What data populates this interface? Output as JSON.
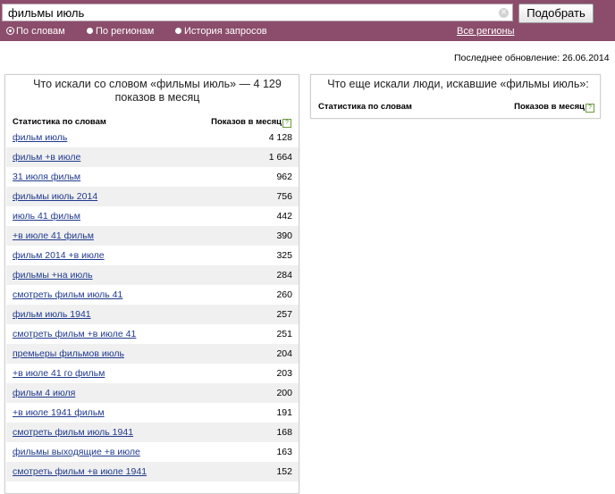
{
  "search": {
    "query": "фильмы июль",
    "submit_label": "Подобрать",
    "clear_glyph": "×"
  },
  "mode_tabs": [
    {
      "label": "По словам",
      "selected": true
    },
    {
      "label": "По регионам",
      "selected": false
    },
    {
      "label": "История запросов",
      "selected": false
    }
  ],
  "regions_link": "Все регионы",
  "last_update": "Последнее обновление: 26.06.2014",
  "left_panel": {
    "title": "Что искали со словом «фильмы июль» — 4 129 показов в месяц",
    "col_words": "Статистика по словам",
    "col_shows": "Показов в месяц",
    "help_glyph": "?",
    "rows": [
      {
        "phrase": "фильм июль",
        "count": "4 128"
      },
      {
        "phrase": "фильм +в июле",
        "count": "1 664"
      },
      {
        "phrase": "31 июля фильм",
        "count": "962"
      },
      {
        "phrase": "фильмы июль 2014",
        "count": "756"
      },
      {
        "phrase": "июль 41 фильм",
        "count": "442"
      },
      {
        "phrase": "+в июле 41 фильм",
        "count": "390"
      },
      {
        "phrase": "фильм 2014 +в июле",
        "count": "325"
      },
      {
        "phrase": "фильмы +на июль",
        "count": "284"
      },
      {
        "phrase": "смотреть фильм июль 41",
        "count": "260"
      },
      {
        "phrase": "фильм июль 1941",
        "count": "257"
      },
      {
        "phrase": "смотреть фильм +в июле 41",
        "count": "251"
      },
      {
        "phrase": "премьеры фильмов июль",
        "count": "204"
      },
      {
        "phrase": "+в июле 41 го фильм",
        "count": "203"
      },
      {
        "phrase": "фильм 4 июля",
        "count": "200"
      },
      {
        "phrase": "+в июле 1941 фильм",
        "count": "191"
      },
      {
        "phrase": "смотреть фильм июль 1941",
        "count": "168"
      },
      {
        "phrase": "фильмы выходящие +в июле",
        "count": "163"
      },
      {
        "phrase": "смотреть фильм +в июле 1941",
        "count": "152"
      }
    ]
  },
  "right_panel": {
    "title": "Что еще искали люди, искавшие «фильмы июль»:",
    "col_words": "Статистика по словам",
    "col_shows": "Показов в месяц",
    "help_glyph": "?"
  },
  "colors": {
    "topbar": "#8b4d6b",
    "link": "#1f3a8e",
    "row_stripe": "#f0f0f0"
  }
}
